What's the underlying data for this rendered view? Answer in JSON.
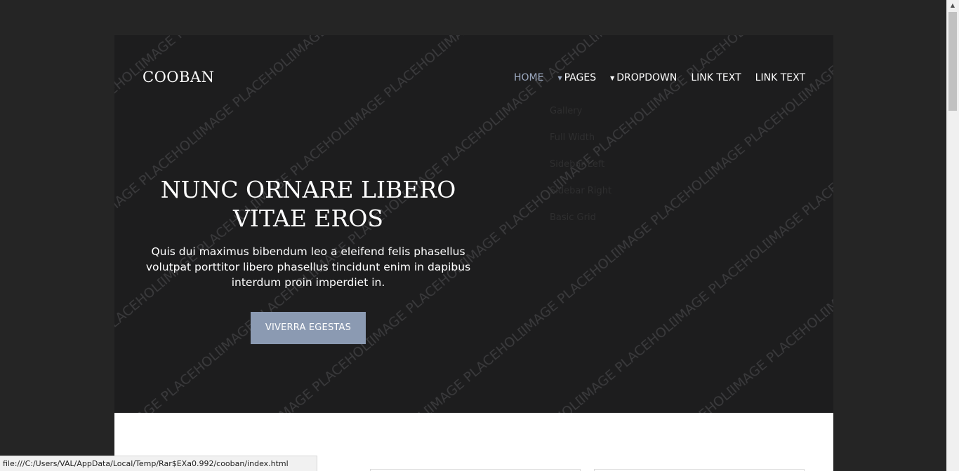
{
  "brand": "COOBAN",
  "nav": {
    "home": "HOME",
    "pages": "PAGES",
    "dropdown": "DROPDOWN",
    "link1": "LINK TEXT",
    "link2": "LINK TEXT"
  },
  "dropdown_items": [
    "Gallery",
    "Full Width",
    "Sidebar Left",
    "Sidebar Right",
    "Basic Grid"
  ],
  "hero": {
    "title": "NUNC ORNARE LIBERO VITAE EROS",
    "text": "Quis dui maximus bibendum leo a eleifend felis phasellus volutpat porttitor libero phasellus tincidunt enim in dapibus interdum proin imperdiet in.",
    "button": "VIVERRA EGESTAS"
  },
  "watermark": "IMAGE PLACEHOLDER",
  "status_url": "file:///C:/Users/VAL/AppData/Local/Temp/Rar$EXa0.992/cooban/index.html",
  "colors": {
    "background": "#252525",
    "hero": "#1d1d1e",
    "accent": "#8b9ab2",
    "active_link": "#9ba8bf"
  }
}
